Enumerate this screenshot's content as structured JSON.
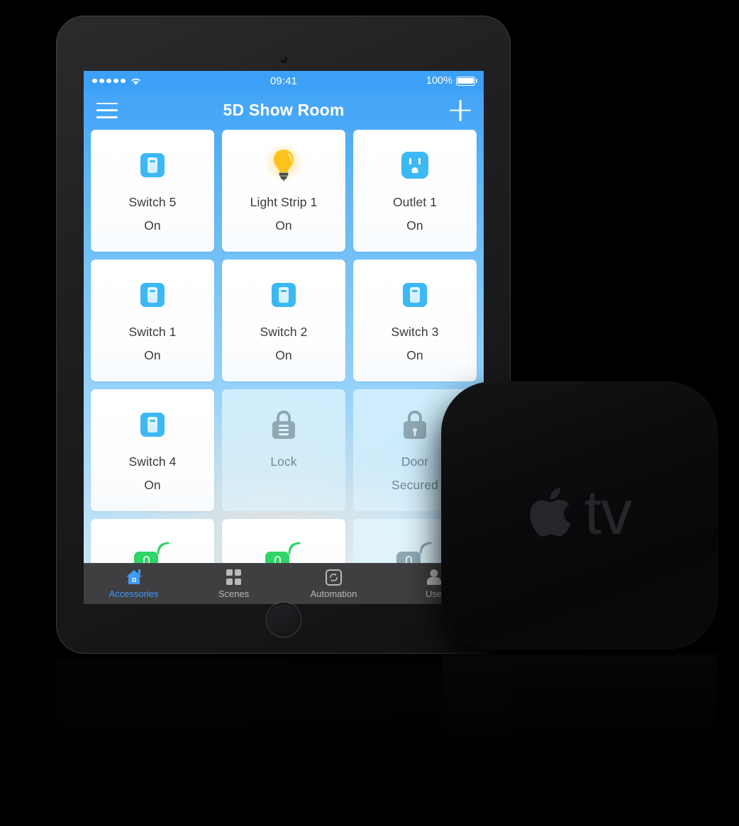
{
  "device": {
    "type": "tablet",
    "camera_icon": "camera-dot",
    "home_button_icon": "home-button"
  },
  "status_bar": {
    "signal_icon": "signal-dots-icon",
    "signal_bars": 5,
    "wifi_icon": "wifi-icon",
    "time": "09:41",
    "battery_percent": "100%",
    "battery_icon": "battery-full-icon",
    "background_color": "#3da0f7"
  },
  "nav_bar": {
    "menu_icon": "hamburger-menu-icon",
    "title": "5D Show Room",
    "add_icon": "plus-icon",
    "background_color": "#4aa9f8"
  },
  "accessories": [
    {
      "name": "Switch 5",
      "state": "On",
      "icon": "light-switch-icon",
      "active": true
    },
    {
      "name": "Light Strip 1",
      "state": "On",
      "icon": "light-bulb-icon",
      "active": true
    },
    {
      "name": "Outlet 1",
      "state": "On",
      "icon": "outlet-icon",
      "active": true
    },
    {
      "name": "Switch 1",
      "state": "On",
      "icon": "light-switch-icon",
      "active": true
    },
    {
      "name": "Switch 2",
      "state": "On",
      "icon": "light-switch-icon",
      "active": true
    },
    {
      "name": "Switch 3",
      "state": "On",
      "icon": "light-switch-icon",
      "active": true
    },
    {
      "name": "Switch 4",
      "state": "On",
      "icon": "light-switch-icon",
      "active": true
    },
    {
      "name": "Lock",
      "state": "",
      "icon": "padlock-icon",
      "active": false
    },
    {
      "name": "Door",
      "state": "Secured",
      "icon": "padlock-keyhole-icon",
      "active": false
    }
  ],
  "partial_row": [
    {
      "icon": "sensor-signal-icon",
      "active": true
    },
    {
      "icon": "sensor-signal-icon",
      "active": true
    },
    {
      "icon": "sensor-signal-icon",
      "active": false
    }
  ],
  "tab_bar": {
    "background_color": "#3f3f41",
    "active_color": "#3f9bf7",
    "inactive_color": "#b9b9bb",
    "tabs": [
      {
        "label": "Accessories",
        "icon": "house-icon",
        "active": true
      },
      {
        "label": "Scenes",
        "icon": "grid-squares-icon",
        "active": false
      },
      {
        "label": "Automation",
        "icon": "refresh-loop-icon",
        "active": false
      },
      {
        "label": "Use",
        "icon": "person-icon",
        "active": false
      }
    ]
  },
  "apple_tv": {
    "apple_logo_icon": "apple-logo-icon",
    "wordmark": "tv",
    "logo_color": "#25262a"
  },
  "theme": {
    "accent_blue": "#3f9bf7",
    "icon_blue": "#3cb8f5",
    "bulb_yellow": "#ffc31e",
    "sensor_green": "#2fd566",
    "dim_gray": "#8fa9b4",
    "tile_white": "#ffffff"
  }
}
